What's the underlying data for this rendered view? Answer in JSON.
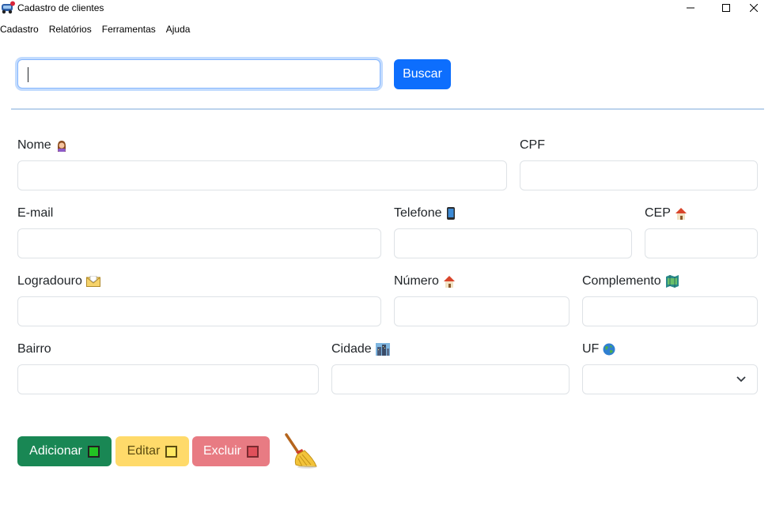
{
  "window": {
    "title": "Cadastro de clientes",
    "icon": "car-icon"
  },
  "menu": [
    {
      "label": "Cadastro"
    },
    {
      "label": "Relatórios"
    },
    {
      "label": "Ferramentas"
    },
    {
      "label": "Ajuda"
    }
  ],
  "search": {
    "value": "",
    "button_label": "Buscar"
  },
  "form": {
    "nome": {
      "label": "Nome",
      "icon": "woman-icon",
      "value": ""
    },
    "cpf": {
      "label": "CPF",
      "value": ""
    },
    "email": {
      "label": "E-mail",
      "value": ""
    },
    "telefone": {
      "label": "Telefone",
      "icon": "phone-icon",
      "value": ""
    },
    "cep": {
      "label": "CEP",
      "icon": "house-icon",
      "value": ""
    },
    "logradouro": {
      "label": "Logradouro",
      "icon": "envelope-icon",
      "value": ""
    },
    "numero": {
      "label": "Número",
      "icon": "house-icon",
      "value": ""
    },
    "complemento": {
      "label": "Complemento",
      "icon": "map-icon",
      "value": ""
    },
    "bairro": {
      "label": "Bairro",
      "value": ""
    },
    "cidade": {
      "label": "Cidade",
      "icon": "city-icon",
      "value": ""
    },
    "uf": {
      "label": "UF",
      "icon": "globe-icon",
      "value": ""
    }
  },
  "actions": {
    "add_label": "Adicionar",
    "edit_label": "Editar",
    "delete_label": "Excluir",
    "clear_icon": "broom-icon"
  },
  "colors": {
    "primary": "#0d6efd",
    "success": "#198754",
    "warning": "#ffda6a",
    "danger": "#e87b83"
  }
}
